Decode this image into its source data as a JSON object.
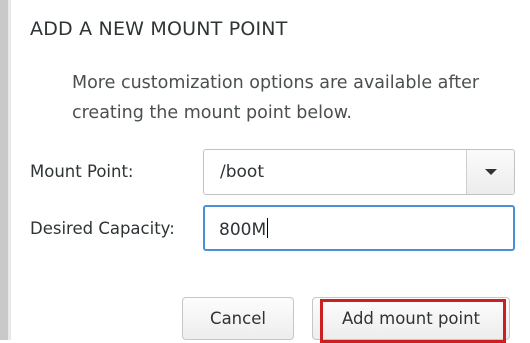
{
  "dialog": {
    "title": "ADD A NEW MOUNT POINT",
    "description": "More customization options are available after creating the mount point below."
  },
  "form": {
    "mount_point_label": "Mount Point:",
    "mount_point_value": "/boot",
    "capacity_label": "Desired Capacity:",
    "capacity_value": "800M"
  },
  "buttons": {
    "cancel_label": "Cancel",
    "add_label": "Add mount point"
  },
  "colors": {
    "focus_border": "#4a90d9",
    "highlight": "#cc1f1f"
  },
  "icons": {
    "dropdown": "chevron-down-icon"
  }
}
